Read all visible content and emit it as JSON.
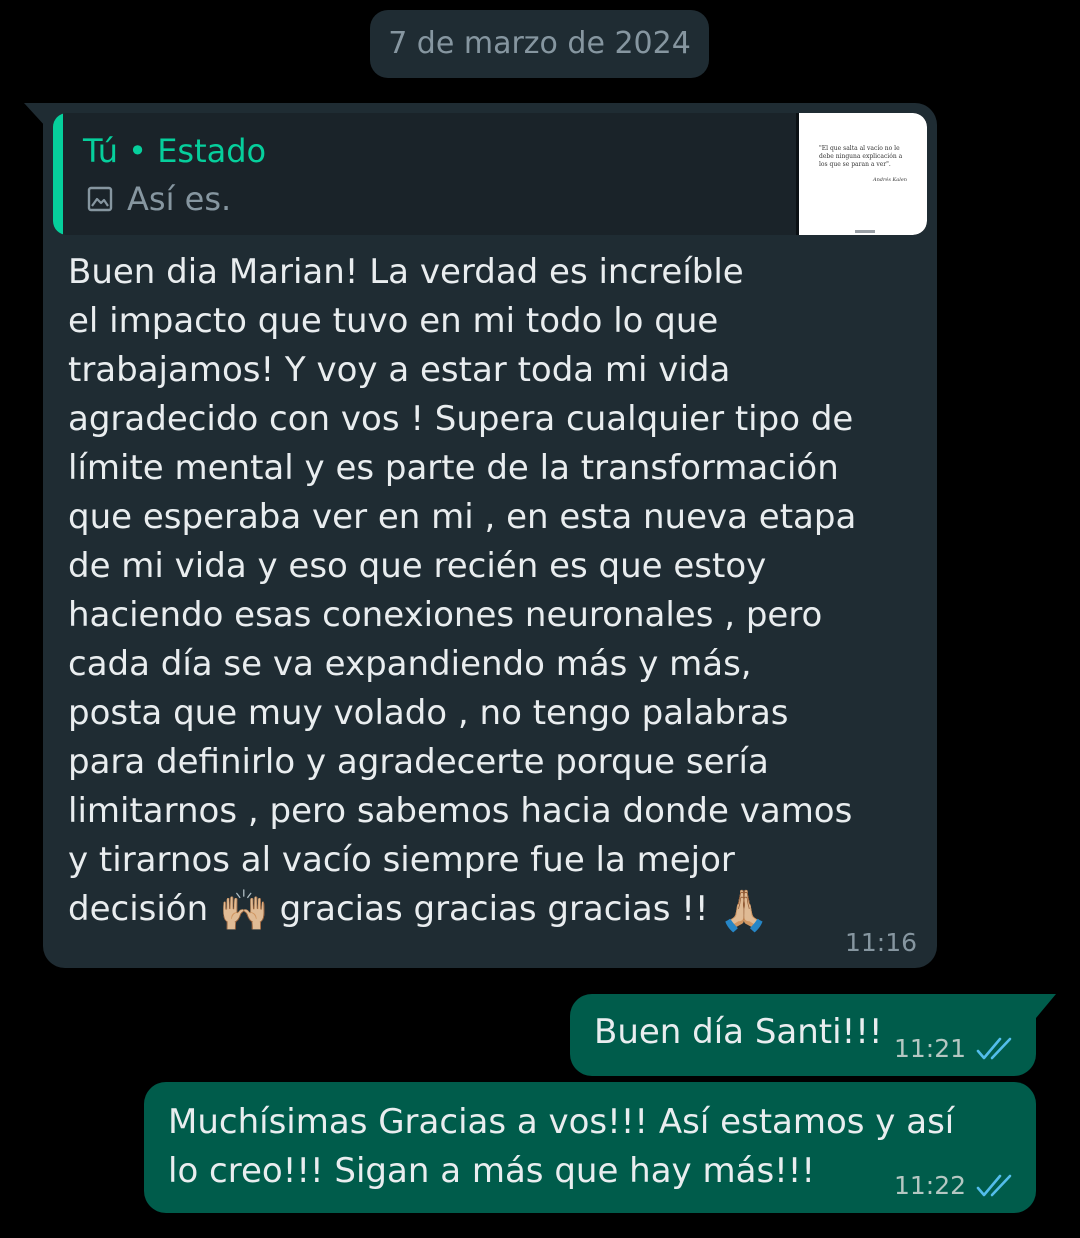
{
  "date_chip": "7 de marzo de 2024",
  "incoming": {
    "quote": {
      "author": "Tú • Estado",
      "icon": "image-icon",
      "text": "Así es.",
      "thumbnail": {
        "quote": "\"El que salta al vacío no le debe ninguna explicación a los que se paran a ver\".",
        "signature": "Andrés Kalen"
      }
    },
    "text": "Buen dia Marian! La verdad es increíble\nel impacto que tuvo en mi todo lo que\ntrabajamos! Y voy a estar toda mi vida\nagradecido con vos ! Supera cualquier tipo de\nlímite mental y es parte de la transformación\nque esperaba ver en mi , en esta nueva etapa\nde mi vida y eso que recién es que estoy\nhaciendo esas conexiones neuronales , pero\ncada día se va expandiendo más y más,\nposta que muy volado , no tengo palabras\npara definirlo y agradecerte porque sería\nlimitarnos , pero sabemos hacia donde vamos\ny tirarnos al vacío siempre fue la mejor",
    "last_line_before": "decisión ",
    "emoji_1": "🙌🏼",
    "last_line_middle": " gracias gracias gracias !! ",
    "emoji_2": "🙏🏼",
    "time": "11:16"
  },
  "outgoing": [
    {
      "text": "Buen día Santi!!!",
      "time": "11:21",
      "status_icon": "double-check-read-icon"
    },
    {
      "text": "Muchísimas Gracias a vos!!! Así estamos y así\nlo creo!!! Sigan a  más que hay más!!!",
      "time": "11:22",
      "status_icon": "double-check-read-icon"
    }
  ],
  "colors": {
    "background": "#000000",
    "incoming_bubble": "#1f2c33",
    "outgoing_bubble": "#005c4b",
    "accent": "#06cf9c",
    "read_check": "#53bdeb"
  }
}
